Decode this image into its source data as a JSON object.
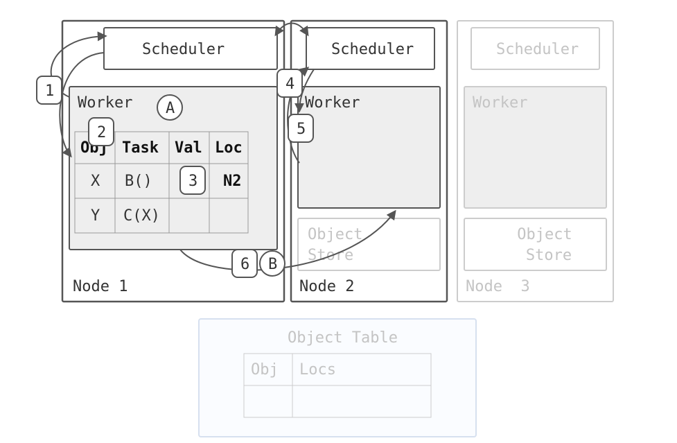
{
  "nodes": [
    {
      "id": "n1",
      "label": "Node 1",
      "scheduler": "Scheduler",
      "worker": "Worker",
      "faded": false
    },
    {
      "id": "n2",
      "label": "Node 2",
      "scheduler": "Scheduler",
      "worker": "Worker",
      "faded": false,
      "store": "Object\nStore"
    },
    {
      "id": "n3",
      "label": "Node  3",
      "scheduler": "Scheduler",
      "worker": "Worker",
      "faded": true,
      "store": "Object\nStore"
    }
  ],
  "workerTable": {
    "headers": [
      "Obj",
      "Task",
      "Val",
      "Loc"
    ],
    "rows": [
      {
        "obj": "X",
        "task": "B()",
        "val": "",
        "loc": "N2"
      },
      {
        "obj": "Y",
        "task": "C(X)",
        "val": "",
        "loc": ""
      }
    ]
  },
  "objectTable": {
    "title": "Object Table",
    "headers": [
      "Obj",
      "Locs"
    ]
  },
  "badges": {
    "step1": "1",
    "step2": "2",
    "step3": "3",
    "step4": "4",
    "step5": "5",
    "step6": "6",
    "labelA": "A",
    "labelB": "B"
  }
}
